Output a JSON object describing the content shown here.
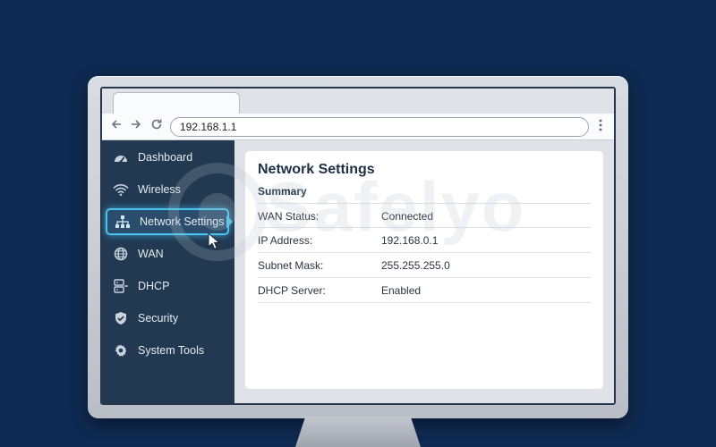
{
  "browser": {
    "url": "192.168.1.1",
    "nav": {
      "back_icon": "back-arrow-icon",
      "forward_icon": "forward-arrow-icon",
      "reload_icon": "reload-icon",
      "menu_icon": "more-vertical-icon"
    }
  },
  "sidebar": {
    "items": [
      {
        "label": "Dashboard",
        "icon": "dashboard-gauge-icon"
      },
      {
        "label": "Wireless",
        "icon": "wifi-icon"
      },
      {
        "label": "Network Settings",
        "icon": "network-topology-icon",
        "active": true
      },
      {
        "label": "WAN",
        "icon": "globe-icon"
      },
      {
        "label": "DHCP",
        "icon": "dhcp-server-icon"
      },
      {
        "label": "Security",
        "icon": "shield-check-icon"
      },
      {
        "label": "System Tools",
        "icon": "gear-icon"
      }
    ]
  },
  "main": {
    "title": "Network Settings",
    "summary_heading": "Summary",
    "rows": [
      {
        "key": "WAN Status:",
        "value": "Connected"
      },
      {
        "key": "IP Address:",
        "value": "192.168.0.1"
      },
      {
        "key": "Subnet Mask:",
        "value": "255.255.255.0"
      },
      {
        "key": "DHCP Server:",
        "value": "Enabled"
      }
    ]
  },
  "watermark": {
    "text": "Safelyo"
  },
  "colors": {
    "background": "#0f2a52",
    "sidebar": "#223951",
    "active_accent": "#49c4f1",
    "title": "#1d3045"
  }
}
